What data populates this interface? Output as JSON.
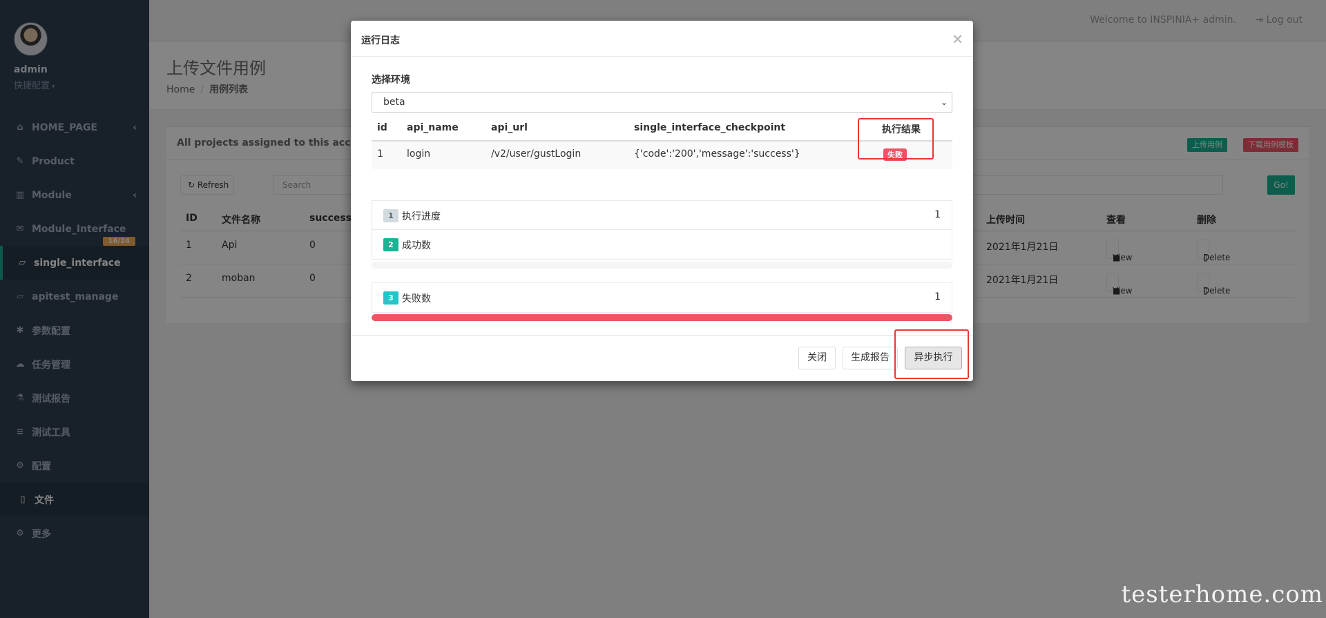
{
  "sidebar": {
    "user_name": "admin",
    "quick_config": "快捷配置",
    "items": [
      {
        "label": "HOME_PAGE",
        "icon": "home-icon"
      },
      {
        "label": "Product",
        "icon": "edit-icon"
      },
      {
        "label": "Module",
        "icon": "bar-chart-icon"
      },
      {
        "label": "Module_Interface",
        "icon": "envelope-icon",
        "badge": "16/24"
      },
      {
        "label": "single_interface",
        "icon": "folder-open-icon"
      },
      {
        "label": "apitest_manage",
        "icon": "folder-open-icon"
      },
      {
        "label": "参数配置",
        "icon": "asterisk-icon"
      },
      {
        "label": "任务管理",
        "icon": "cloud-upload-icon"
      },
      {
        "label": "测试报告",
        "icon": "flask-icon"
      },
      {
        "label": "测试工具",
        "icon": "database-icon"
      },
      {
        "label": "配置",
        "icon": "gear-icon"
      },
      {
        "label": "文件",
        "icon": "file-icon"
      },
      {
        "label": "更多",
        "icon": "gears-icon"
      }
    ]
  },
  "topbar": {
    "welcome": "Welcome to INSPINIA+ admin.",
    "logout": "Log out"
  },
  "heading": {
    "title": "上传文件用例",
    "crumb_home": "Home",
    "crumb_current": "用例列表"
  },
  "ibox": {
    "title": "All projects assigned to this account",
    "upload_label": "上传用例",
    "download_label": "下载用例模板",
    "refresh_label": "Refresh",
    "search_placeholder": "Search",
    "go_label": "Go!",
    "columns": {
      "id": "ID",
      "name": "文件名称",
      "success": "success",
      "time": "上传时间",
      "view": "查看",
      "delete": "删除"
    },
    "rows": [
      {
        "id": "1",
        "name": "Api",
        "success": "0",
        "time": "2021年1月21日",
        "view": "View",
        "delete": "Delete"
      },
      {
        "id": "2",
        "name": "moban",
        "success": "0",
        "time": "2021年1月21日",
        "view": "View",
        "delete": "Delete"
      }
    ]
  },
  "modal": {
    "title": "运行日志",
    "close_glyph": "×",
    "env_label": "选择环境",
    "env_value": "beta",
    "table": {
      "headers": {
        "id": "id",
        "api_name": "api_name",
        "api_url": "api_url",
        "checkpoint": "single_interface_checkpoint",
        "result": "执行结果"
      },
      "rows": [
        {
          "id": "1",
          "api_name": "login",
          "api_url": "/v2/user/gustLogin",
          "checkpoint": "{'code':'200','message':'success'}",
          "result": "失败"
        }
      ]
    },
    "progress_list": [
      {
        "num": "1",
        "label": "执行进度",
        "value": "1"
      },
      {
        "num": "2",
        "label": "成功数",
        "value": ""
      }
    ],
    "success_fraction": 0,
    "fail_item": {
      "num": "3",
      "label": "失败数",
      "value": "1"
    },
    "fail_fraction": 1,
    "buttons": {
      "close": "关闭",
      "report": "生成报告",
      "async_run": "异步执行"
    }
  },
  "watermark": "testerhome.com",
  "colors": {
    "sidebar_bg": "#2f4050",
    "accent": "#1ab394",
    "danger": "#ed5565",
    "highlight_box": "#e53935",
    "info": "#23c6c8"
  }
}
